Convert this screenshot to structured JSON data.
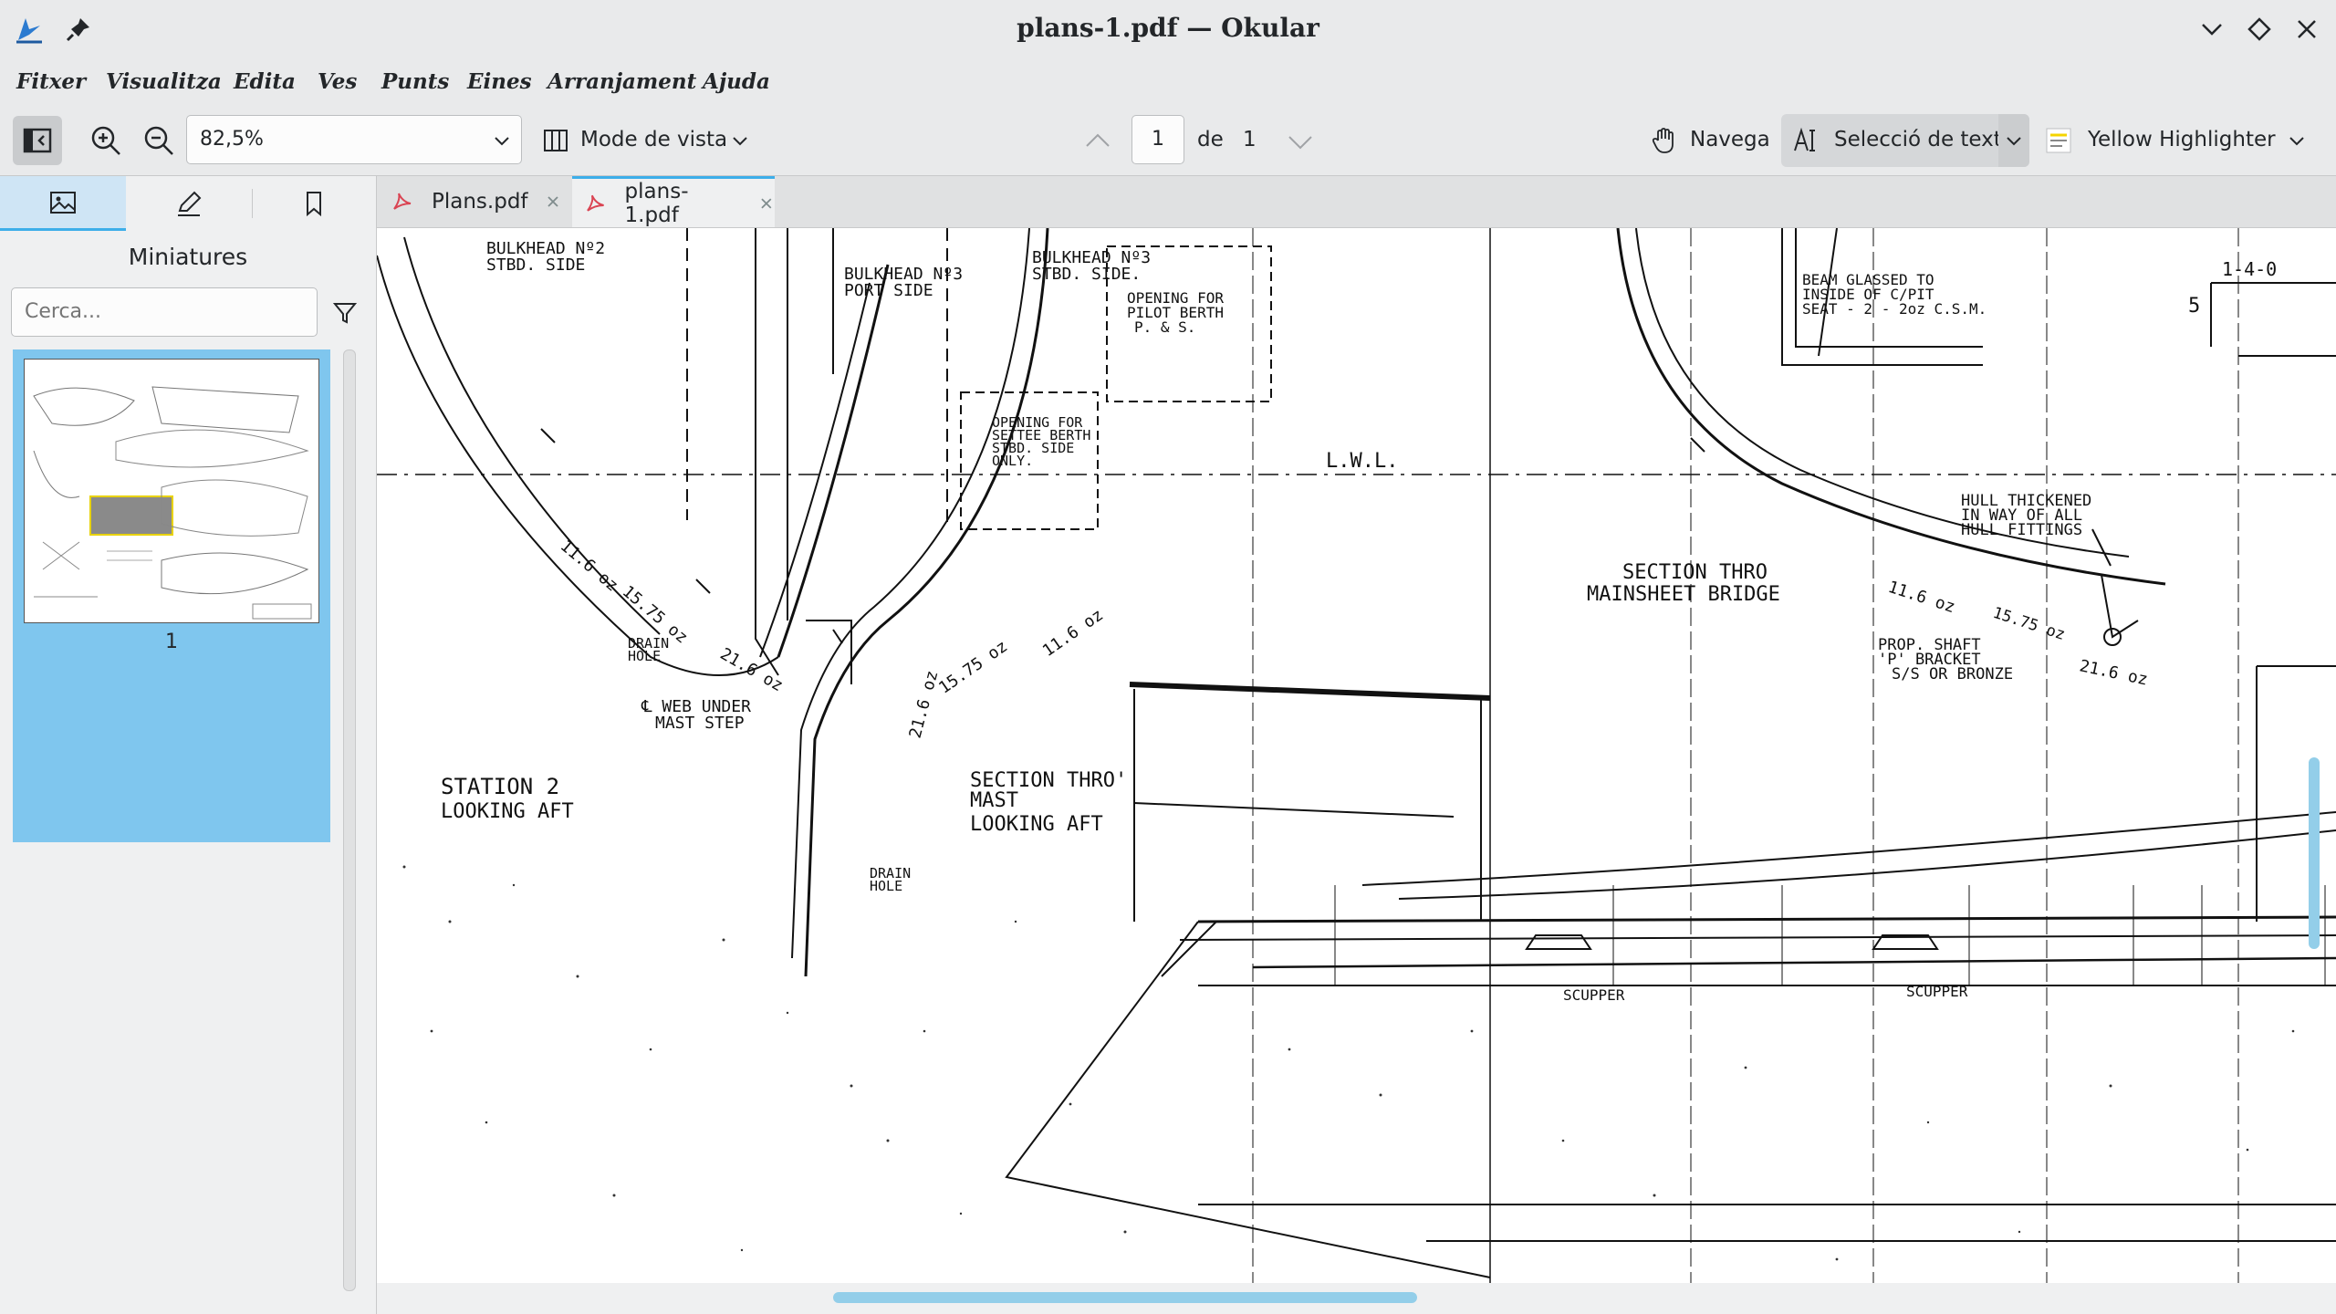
{
  "window": {
    "title": "plans-1.pdf — Okular"
  },
  "menu": [
    "Fitxer",
    "Visualitza",
    "Edita",
    "Ves",
    "Punts",
    "Eines",
    "Arranjament",
    "Ajuda"
  ],
  "toolbar": {
    "zoom_value": "82,5%",
    "view_mode_label": "Mode de vista",
    "page_current": "1",
    "page_of_label": "de",
    "page_total": "1",
    "browse_label": "Navega",
    "text_select_label": "Selecció de text",
    "highlighter_label": "Yellow Highlighter"
  },
  "sidebar": {
    "heading": "Miniatures",
    "search_placeholder": "Cerca...",
    "thumbnail_page": "1"
  },
  "tabs": [
    {
      "label": "Plans.pdf",
      "active": false
    },
    {
      "label": "plans-1.pdf",
      "active": true
    }
  ],
  "drawing_labels": {
    "bulkhead2": "BULKHEAD Nº2",
    "stbd_side": "STBD. SIDE",
    "bulkhead3_port": "BULKHEAD Nº3",
    "port_side": "PORT SIDE",
    "bulkhead3_stbd": "BULKHEAD Nº3",
    "stbd_side2": "STBD. SIDE.",
    "opening_pilot1": "OPENING FOR",
    "opening_pilot2": "PILOT BERTH",
    "opening_pilot3": "P. & S.",
    "opening_settee1": "OPENING FOR",
    "opening_settee2": "SETTEE BERTH",
    "opening_settee3": "STBD. SIDE",
    "opening_settee4": "ONLY.",
    "lwl": "L.W.L.",
    "w116": "11.6 oz",
    "w1575": "15.75 oz",
    "w216": "21.6 oz",
    "drain_hole1": "DRAIN",
    "drain_hole2": "HOLE",
    "web_under1": "℄ WEB UNDER",
    "web_under2": "MAST STEP",
    "station2_1": "STATION  2",
    "station2_2": "LOOKING  AFT",
    "section_mast1": "SECTION  THRO'",
    "section_mast2": "MAST",
    "section_mast3": "LOOKING  AFT",
    "section_bridge1": "SECTION  THRO",
    "section_bridge2": "MAINSHEET  BRIDGE",
    "beam1": "BEAM GLASSED TO",
    "beam2": "INSIDE OF C/PIT",
    "beam3": "SEAT - 2 - 2oz C.S.M.",
    "hull1": "HULL THICKENED",
    "hull2": "IN WAY OF ALL",
    "hull3": "HULL FITTINGS",
    "prop1": "PROP. SHAFT",
    "prop2": "'P' BRACKET",
    "prop3": "S/S OR BRONZE",
    "dim_140": "1-4-0",
    "dim_5": "5",
    "scupper": "SCUPPER"
  },
  "colors": {
    "accent": "#3daee9",
    "selection": "#7fc6ee",
    "toolbar_bg": "#e9eaeb"
  }
}
